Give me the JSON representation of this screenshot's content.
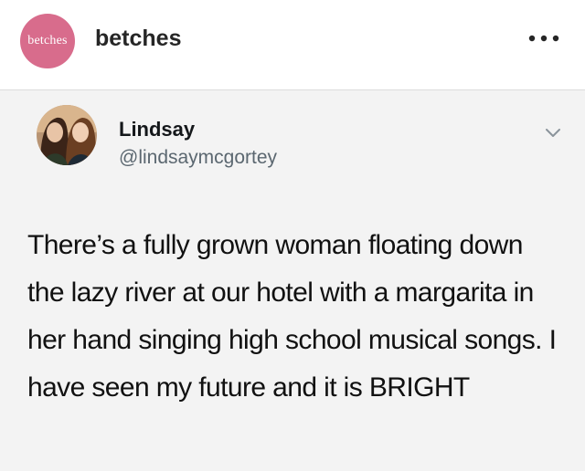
{
  "instagram_post": {
    "account_username": "betches",
    "avatar_text": "betches",
    "avatar_color": "#d86c8c"
  },
  "tweet": {
    "display_name": "Lindsay",
    "handle": "@lindsaymcgortey",
    "text": "There’s a fully grown woman floating down the lazy river at our hotel with a margarita in her hand singing high school musical songs. I have seen my future and it is BRIGHT"
  },
  "icons": {
    "more": "more-horizontal-icon",
    "caret": "chevron-down-icon"
  }
}
